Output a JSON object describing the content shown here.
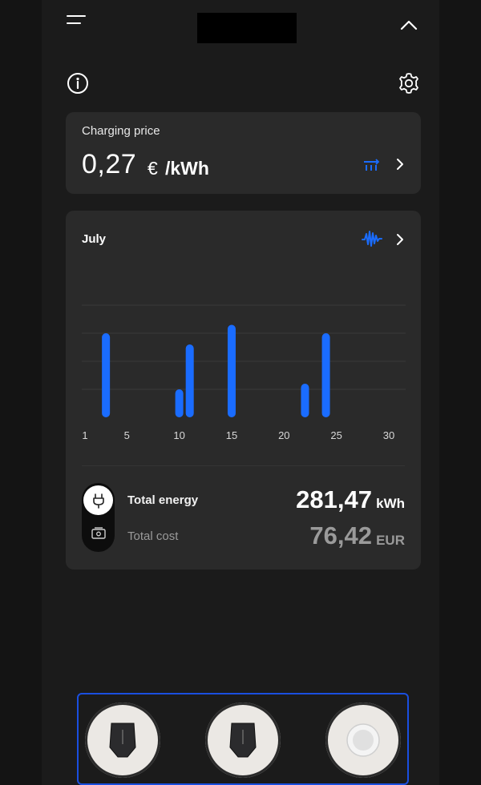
{
  "header": {
    "menu_icon": "hamburger-menu-icon",
    "collapse_icon": "chevron-up-icon"
  },
  "toolbar": {
    "info_icon": "info-icon",
    "settings_icon": "gear-icon"
  },
  "price_card": {
    "label": "Charging price",
    "value": "0,27",
    "currency": "€",
    "unit": "/kWh",
    "icon": "tariff-list-icon"
  },
  "stats_card": {
    "month": "July",
    "icon": "waveform-icon",
    "total_energy_label": "Total energy",
    "total_energy_value": "281,47",
    "total_energy_unit": "kWh",
    "total_cost_label": "Total cost",
    "total_cost_value": "76,42",
    "total_cost_unit": "EUR"
  },
  "chart_data": {
    "type": "bar",
    "x": [
      3,
      10,
      11,
      15,
      22,
      24
    ],
    "values": [
      3,
      1,
      2.6,
      3.3,
      1.2,
      3
    ],
    "xticks": [
      "1",
      "5",
      "10",
      "15",
      "20",
      "25",
      "30"
    ],
    "xlim": [
      1,
      30
    ],
    "ylim": [
      0,
      4
    ],
    "grid": true,
    "bar_color": "#1a6cff"
  },
  "devices": [
    {
      "icon": "wallbox-charger-icon"
    },
    {
      "icon": "wallbox-charger-icon"
    },
    {
      "icon": "round-charger-icon"
    }
  ],
  "colors": {
    "accent": "#1a6cff",
    "background": "#1b1b1b",
    "card": "#2a2a2a",
    "selection_border": "#1a4fe0"
  }
}
